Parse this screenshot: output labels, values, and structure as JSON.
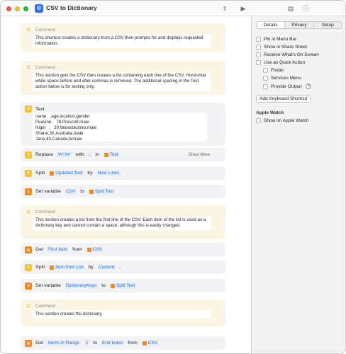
{
  "window": {
    "title": "CSV to Dictionary"
  },
  "comments": [
    {
      "header": "Comment",
      "text": "This shortcut creates a dictionary from a CSV then prompts for and displays requested information."
    },
    {
      "header": "Comment",
      "text": "This section gets the CSV then creates a list containing each line of the CSV. Horizontal white space before and after commas is removed. The additional spacing in the Text action below is for testing only."
    },
    {
      "header": "Comment",
      "text": "This section creates a list from the first line of the CSV. Each item of the list is used as a dictionary key and cannot contain a space, although this is easily changed."
    },
    {
      "header": "Comment",
      "text": "This section creates the dictionary."
    }
  ],
  "text_action": {
    "label": "Text",
    "content": "name   ,age,location,gender\nPeavine,   78,Prescott,male\nNigel   ,   20,Warwickshire,male\nShane,30,Australia,male\nJane,40,Canada,female"
  },
  "replace_action": {
    "verb": "Replace",
    "pattern": "\\h*,\\h*",
    "with": "with",
    "replacement": ",",
    "in": "in",
    "target": "Text",
    "show_more": "Show More"
  },
  "split1": {
    "verb": "Split",
    "input": "Updated Text",
    "by": "by",
    "separator": "New Lines"
  },
  "setvar1": {
    "verb": "Set variable",
    "name": "CSV",
    "to": "to",
    "value": "Split Text"
  },
  "get1": {
    "verb": "Get",
    "item": "First Item",
    "from": "from",
    "source": "CSV"
  },
  "split2": {
    "verb": "Split",
    "input": "Item from List",
    "by": "by",
    "separator": "Custom",
    "custom": ","
  },
  "setvar2": {
    "verb": "Set variable",
    "name": "DictionaryKeys",
    "to": "to",
    "value": "Split Text"
  },
  "get2": {
    "verb": "Get",
    "item": "Items in Range",
    "start": "2",
    "to": "to",
    "end": "End Index",
    "from": "from",
    "source": "CSV"
  },
  "sidebar": {
    "tabs": [
      "Details",
      "Privacy",
      "Setup"
    ],
    "active_tab": "Details",
    "options": [
      "Pin in Menu Bar",
      "Show in Share Sheet",
      "Receive What's On Screen",
      "Use as Quick Action"
    ],
    "sub_options": [
      "Finder",
      "Services Menu",
      "Provide Output"
    ],
    "button": "Add Keyboard Shortcut",
    "watch_title": "Apple Watch",
    "watch_option": "Show on Apple Watch"
  },
  "colors": {
    "accent": "#2a6fd8",
    "comment_bg": "#fbf6e3",
    "action_bg": "#f3f3f5",
    "text_icon": "#f3c237",
    "variable_icon": "#f08a24"
  }
}
